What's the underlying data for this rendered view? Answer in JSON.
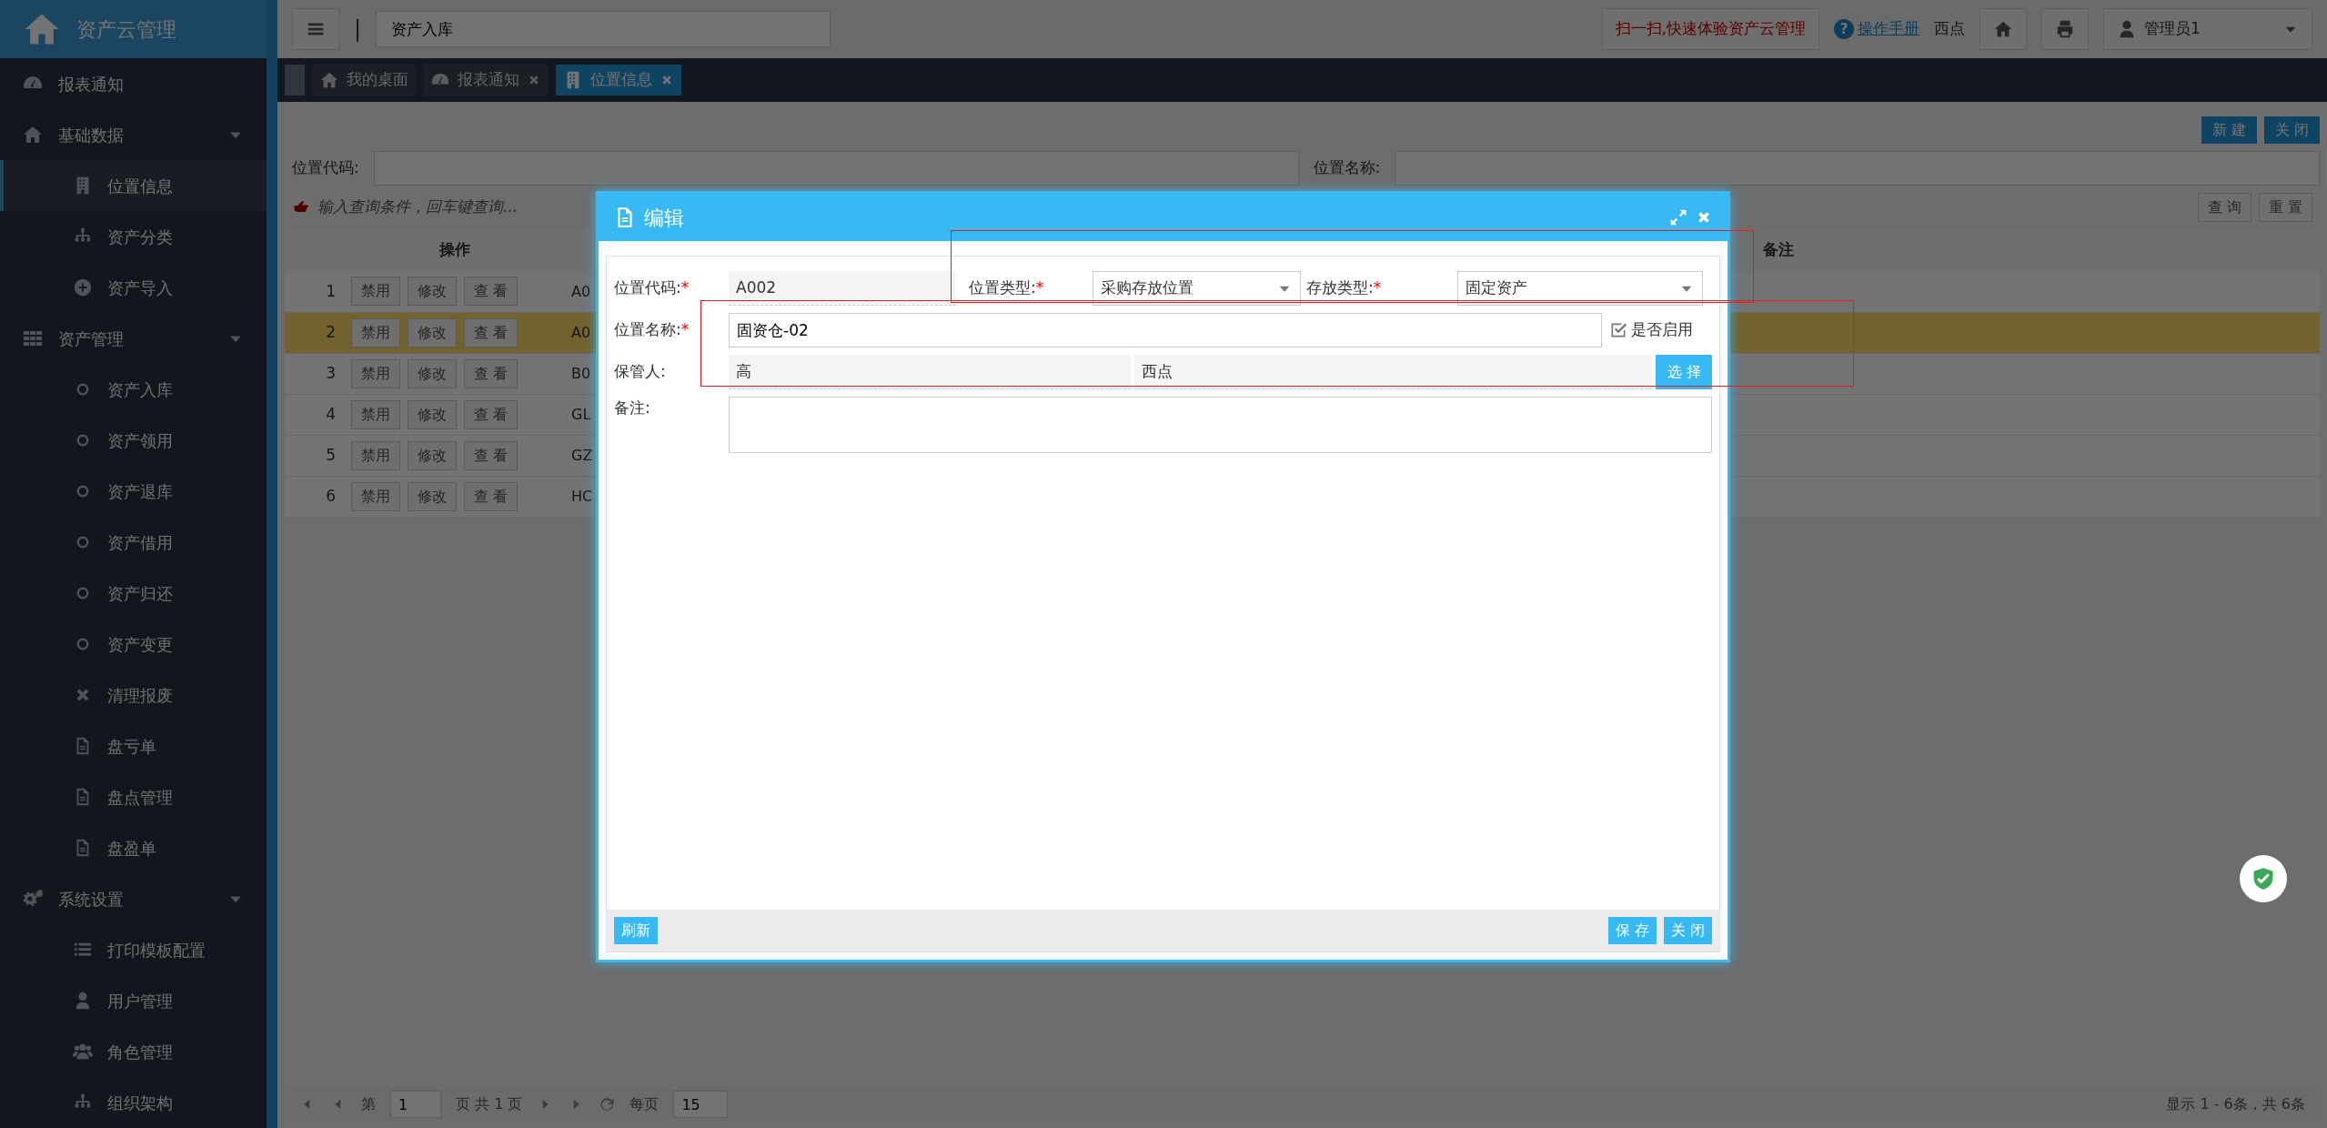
{
  "app": {
    "title": "资产云管理"
  },
  "topbar": {
    "search_value": "资产入库",
    "separator": "|",
    "promo": "扫一扫,快速体验资产云管理",
    "help_mark": "?",
    "help_link": "操作手册",
    "location": "西点",
    "user": "管理员1"
  },
  "sidebar": {
    "items": [
      {
        "label": "报表通知",
        "selected": false
      },
      {
        "label": "基础数据",
        "selected": false,
        "expanded": true,
        "children": [
          {
            "label": "位置信息",
            "selected": true
          },
          {
            "label": "资产分类",
            "selected": false
          },
          {
            "label": "资产导入",
            "selected": false
          }
        ]
      },
      {
        "label": "资产管理",
        "selected": false,
        "expanded": true,
        "children": [
          {
            "label": "资产入库",
            "selected": false
          },
          {
            "label": "资产领用",
            "selected": false
          },
          {
            "label": "资产退库",
            "selected": false
          },
          {
            "label": "资产借用",
            "selected": false
          },
          {
            "label": "资产归还",
            "selected": false
          },
          {
            "label": "资产变更",
            "selected": false
          },
          {
            "label": "清理报废",
            "selected": false
          },
          {
            "label": "盘亏单",
            "selected": false
          },
          {
            "label": "盘点管理",
            "selected": false
          },
          {
            "label": "盘盈单",
            "selected": false
          }
        ]
      },
      {
        "label": "系统设置",
        "selected": false,
        "expanded": true,
        "children": [
          {
            "label": "打印模板配置",
            "selected": false
          },
          {
            "label": "用户管理",
            "selected": false
          },
          {
            "label": "角色管理",
            "selected": false
          },
          {
            "label": "组织架构",
            "selected": false
          }
        ]
      }
    ]
  },
  "tabs": [
    {
      "label": "我的桌面",
      "selected": false,
      "closable": false
    },
    {
      "label": "报表通知",
      "selected": false,
      "closable": true
    },
    {
      "label": "位置信息",
      "selected": true,
      "closable": true
    }
  ],
  "content": {
    "buttons": [
      "新 建",
      "关 闭"
    ],
    "filters": [
      {
        "label": "位置代码:"
      },
      {
        "label": "位置名称:"
      }
    ],
    "hint": "输入查询条件，回车键查询...",
    "search_buttons": [
      "查 询",
      "重 置"
    ],
    "table": {
      "columns": [
        "操作",
        "备注"
      ],
      "rows": [
        {
          "index": "1",
          "actions": [
            "禁用",
            "修改",
            "查 看"
          ],
          "column_3": "A0",
          "selected": false
        },
        {
          "index": "2",
          "actions": [
            "禁用",
            "修改",
            "查 看"
          ],
          "column_3": "A0",
          "selected": true
        },
        {
          "index": "3",
          "actions": [
            "禁用",
            "修改",
            "查 看"
          ],
          "column_3": "B0",
          "selected": false
        },
        {
          "index": "4",
          "actions": [
            "禁用",
            "修改",
            "查 看"
          ],
          "column_3": "GL",
          "selected": false
        },
        {
          "index": "5",
          "actions": [
            "禁用",
            "修改",
            "查 看"
          ],
          "column_3": "GZ",
          "selected": false
        },
        {
          "index": "6",
          "actions": [
            "禁用",
            "修改",
            "查 看"
          ],
          "column_3": "HC",
          "selected": false
        }
      ]
    },
    "pagination": {
      "page_prefix": "第",
      "page": "1",
      "page_suffix": "页 共 1 页",
      "per_page_label": "每页",
      "per_page": "15",
      "summary": "显示 1 - 6条，共 6条"
    }
  },
  "modal": {
    "title": "编辑",
    "code": {
      "label": "位置代码:",
      "mark": "*",
      "value": "A002"
    },
    "type": {
      "label": "位置类型:",
      "mark": "*",
      "value": "采购存放位置"
    },
    "storage": {
      "label": "存放类型:",
      "mark": "*",
      "value": "固定资产"
    },
    "name": {
      "label": "位置名称:",
      "mark": "*",
      "value": "固资仓-02"
    },
    "enabled": {
      "label": "是否启用",
      "checked": true
    },
    "keeper": {
      "label": "保管人:",
      "values": [
        "高",
        "西点"
      ],
      "button": "选 择"
    },
    "remark": {
      "label": "备注:"
    },
    "footer_left": "刷新",
    "footer_right": [
      "保 存",
      "关 闭"
    ]
  }
}
